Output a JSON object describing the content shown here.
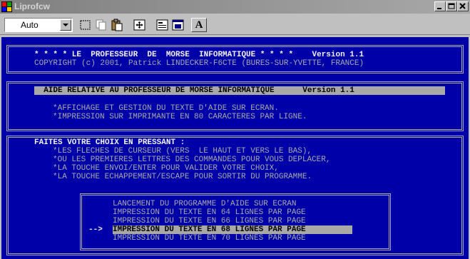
{
  "window": {
    "title": "Liprofcw",
    "minimize_icon": "minimize-icon",
    "maximize_icon": "maximize-icon",
    "close_icon": "close-icon"
  },
  "toolbar": {
    "font_size_value": "Auto",
    "icons": [
      "mark-icon",
      "copy-icon",
      "paste-icon",
      "fullscreen-icon",
      "properties-icon",
      "background-icon",
      "font-icon"
    ],
    "font_button_label": "A"
  },
  "header": {
    "line1": "* * * * LE  PROFESSEUR  DE  MORSE  INFORMATIQUE * * * *    Version 1.1",
    "line2": "COPYRIGHT (c) 2001, Patrick LINDECKER-F6CTE (BURES-SUR-YVETTE, FRANCE)"
  },
  "help_box": {
    "title_bar": "  AIDE RELATIVE AU PROFESSEUR DE MORSE INFORMATIQUE      Version 1.1 ",
    "items": [
      "*AFFICHAGE ET GESTION DU TEXTE D'AIDE SUR ECRAN.",
      "*IMPRESSION SUR IMPRIMANTE EN 80 CARACTERES PAR LIGNE."
    ]
  },
  "choice_box": {
    "heading": "FAITES VOTRE CHOIX EN PRESSANT :",
    "items": [
      "*LES FLECHES DE CURSEUR (VERS  LE HAUT ET VERS LE BAS),",
      "*OU LES PREMIERES LETTRES DES COMMANDES POUR VOUS DEPLACER,",
      "*LA TOUCHE ENVOI/ENTER POUR VALIDER VOTRE CHOIX,",
      "*LA TOUCHE ECHAPPEMENT/ESCAPE POUR SORTIR DU PROGRAMME."
    ]
  },
  "menu": {
    "options": [
      "LANCEMENT DU PROGRAMME D'AIDE SUR ECRAN",
      "IMPRESSION DU TEXTE EN 64 LIGNES PAR PAGE",
      "IMPRESSION DU TEXTE EN 66 LIGNES PAR PAGE",
      "IMPRESSION DU TEXTE EN 68 LIGNES PAR PAGE",
      "IMPRESSION DU TEXTE EN 70 LIGNES PAR PAGE"
    ],
    "selected_index": 3,
    "cursor": "-->"
  },
  "colors": {
    "screen_bg": "#0000a8",
    "frame": "#a8a8a8",
    "bright_text": "#f2f2f2",
    "dim_text": "#a8a8a8",
    "highlight_bg": "#a8a8a8",
    "highlight_text": "#000000"
  }
}
